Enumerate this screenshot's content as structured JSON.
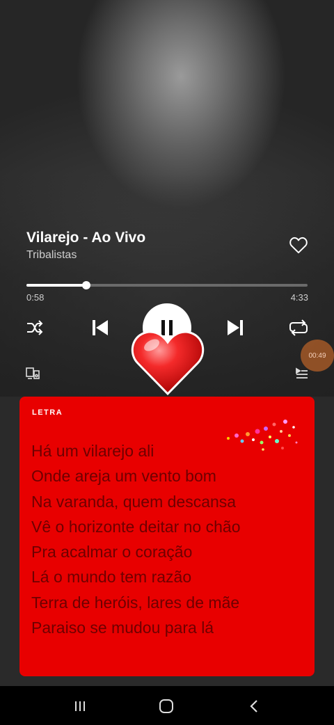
{
  "track": {
    "title": "Vilarejo - Ao Vivo",
    "artist": "Tribalistas"
  },
  "progress": {
    "elapsed": "0:58",
    "total": "4:33",
    "fraction": 0.212
  },
  "overlay": {
    "timer_text": "00:49"
  },
  "lyrics": {
    "heading": "LETRA",
    "lines": [
      "Há um vilarejo ali",
      "Onde areja um vento bom",
      "Na varanda, quem descansa",
      "Vê o horizonte deitar no chão",
      "Pra acalmar o coração",
      "Lá o mundo tem razão",
      "Terra de heróis, lares de mãe",
      "Paraiso se mudou para lá"
    ]
  },
  "icons": {
    "like": "heart-outline-icon",
    "shuffle": "shuffle-icon",
    "previous": "skip-previous-icon",
    "pause": "pause-icon",
    "next": "skip-next-icon",
    "repeat": "repeat-icon",
    "devices": "connect-devices-icon",
    "queue": "queue-icon",
    "sticker": "red-heart-sticker",
    "nav_recents": "recent-apps-icon",
    "nav_home": "home-icon",
    "nav_back": "back-icon"
  },
  "colors": {
    "lyrics_bg": "#e80000",
    "lyrics_text": "#6e0000",
    "background": "#2a2a2a"
  }
}
